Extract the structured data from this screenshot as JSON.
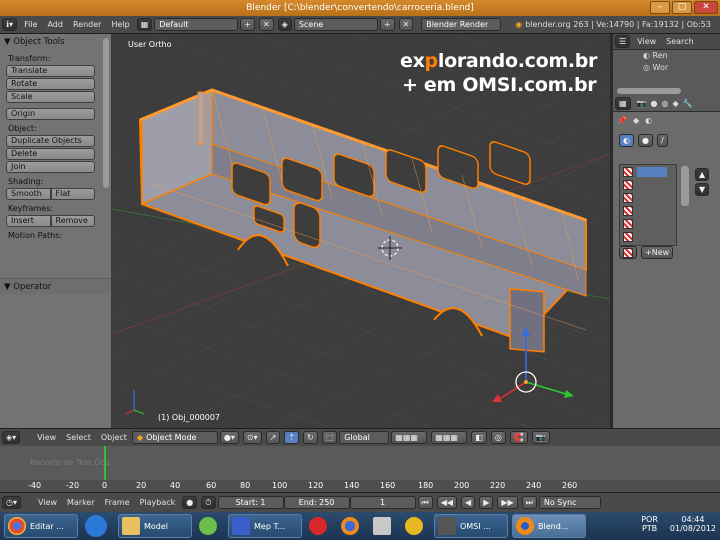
{
  "window": {
    "title": "Blender [C:\\blender\\convertendo\\carroceria.blend]",
    "buttons": [
      "–",
      "□",
      "✕"
    ]
  },
  "infobar": {
    "menus": [
      "File",
      "Add",
      "Render",
      "Help"
    ],
    "layout": "Default",
    "scene": "Scene",
    "engine": "Blender Render",
    "stats": "blender.org 263 | Ve:14790 | Fa:19132 | Ob:53"
  },
  "toolshelf": {
    "title": "Object Tools",
    "transform_label": "Transform:",
    "translate": "Translate",
    "rotate": "Rotate",
    "scale": "Scale",
    "origin": "Origin",
    "object_label": "Object:",
    "duplicate": "Duplicate Objects",
    "delete": "Delete",
    "join": "Join",
    "shading_label": "Shading:",
    "smooth": "Smooth",
    "flat": "Flat",
    "keyframes_label": "Keyframes:",
    "insert": "Insert",
    "remove": "Remove",
    "motion_label": "Motion Paths:",
    "operator": "Operator"
  },
  "viewport": {
    "view_name": "User Ortho",
    "object_name": "(1) Obj_000007",
    "watermark_line1_a": "ex",
    "watermark_line1_b": "p",
    "watermark_line1_c": "lorando.com.br",
    "watermark_line2": "+ em OMSI.com.br"
  },
  "outliner": {
    "view": "View",
    "search": "Search",
    "rows": [
      "Ren",
      "Wor"
    ]
  },
  "properties": {
    "new_button": "New"
  },
  "view3d_header": {
    "menus": [
      "View",
      "Select",
      "Object"
    ],
    "mode": "Object Mode",
    "orientation": "Global"
  },
  "timeline": {
    "ghost_text": "Recorte de Tela Ocu",
    "ticks": [
      "-40",
      "-20",
      "0",
      "20",
      "40",
      "60",
      "80",
      "100",
      "120",
      "140",
      "160",
      "180",
      "200",
      "220",
      "240",
      "260"
    ],
    "menus": [
      "View",
      "Marker",
      "Frame",
      "Playback"
    ],
    "start": "Start: 1",
    "end": "End: 250",
    "current": "1",
    "sync": "No Sync"
  },
  "taskbar": {
    "items": [
      "Editar ...",
      "Model",
      "Mep T...",
      "OMSI ...",
      "Blend..."
    ],
    "lang1": "POR",
    "lang2": "PTB",
    "time": "04:44",
    "date": "01/08/2012"
  },
  "colors": {
    "accent_orange": "#ff7f00",
    "title_bar": "#c57d22",
    "selection_blue": "#5680c2"
  }
}
